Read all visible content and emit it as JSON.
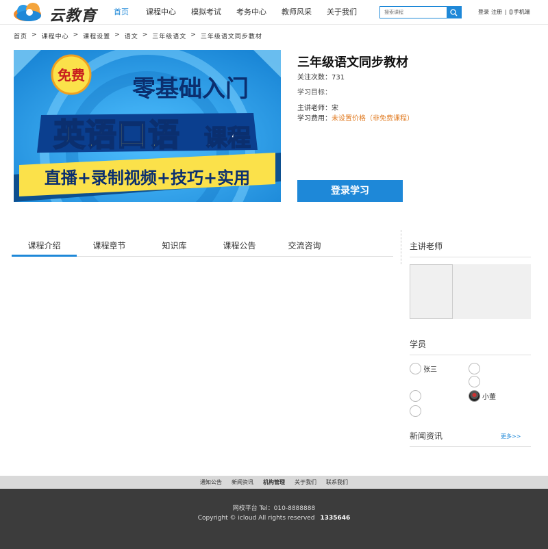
{
  "header": {
    "logo_text": "云教育",
    "nav": [
      {
        "label": "首页",
        "active": true
      },
      {
        "label": "课程中心",
        "active": false
      },
      {
        "label": "模拟考试",
        "active": false
      },
      {
        "label": "考务中心",
        "active": false
      },
      {
        "label": "教师风采",
        "active": false
      },
      {
        "label": "关于我们",
        "active": false
      }
    ],
    "search_placeholder": "搜索课程",
    "login": "登录",
    "register": "注册",
    "separator": "|",
    "mobile": "手机端"
  },
  "breadcrumb": {
    "items": [
      "首页",
      "课程中心",
      "课程设置",
      "语文",
      "三年级语文",
      "三年级语文同步教材"
    ],
    "arrow": ">"
  },
  "banner": {
    "badge": "免费",
    "line1": "零基础入门",
    "line2": "英语口语",
    "line2_suffix": "课程",
    "ribbon": "直播+录制视频+技巧+实用"
  },
  "course": {
    "title": "三年级语文同步教材",
    "followers_label": "关注次数：",
    "followers_value": "731",
    "goal_label": "学习目标：",
    "teacher_label": "主讲老师：",
    "teacher_value": "宋",
    "fee_label": "学习费用：",
    "fee_value": "未设置价格（非免费课程）",
    "study_button": "登录学习"
  },
  "tabs": [
    "课程介绍",
    "课程章节",
    "知识库",
    "课程公告",
    "交流咨询"
  ],
  "sidebar": {
    "teacher_title": "主讲老师",
    "students_title": "学员",
    "students": [
      "张三",
      "",
      "",
      "小董",
      "",
      ""
    ],
    "news_title": "新闻资讯",
    "more": "更多>>"
  },
  "footer": {
    "links": [
      "通知公告",
      "新闻资讯",
      "机构管理",
      "关于我们",
      "联系我们"
    ],
    "line1": "网校平台   Tel：010-8888888",
    "copyright": "Copyright © icloud All rights reserved",
    "count": "1335646"
  },
  "colors": {
    "accent": "#1e88d8",
    "price": "#e07a20",
    "footer_bg": "#3c3c3c"
  }
}
